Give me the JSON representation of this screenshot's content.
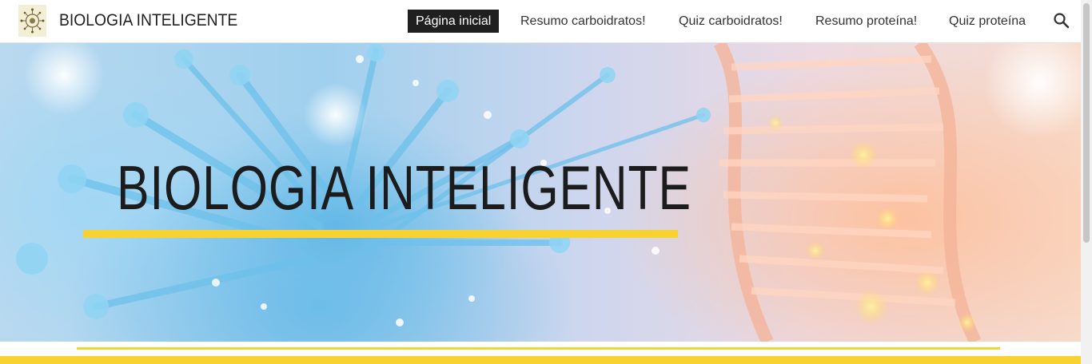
{
  "header": {
    "logo": {
      "icon": "microbe-logo-icon"
    },
    "site_title": "BIOLOGIA INTELIGENTE",
    "nav": [
      {
        "label": "Página inicial",
        "active": true
      },
      {
        "label": "Resumo carboidratos!",
        "active": false
      },
      {
        "label": "Quiz carboidratos!",
        "active": false
      },
      {
        "label": "Resumo proteína!",
        "active": false
      },
      {
        "label": "Quiz proteína",
        "active": false
      }
    ],
    "search": {
      "icon": "search-icon"
    }
  },
  "hero": {
    "title": "BIOLOGIA INTELIGENTE",
    "accent_color": "#f7d230",
    "background": "virus and DNA helix illustration"
  },
  "theme": {
    "accent": "#f7d230",
    "active_nav_bg": "#1f1f1f",
    "text": "#222222"
  }
}
